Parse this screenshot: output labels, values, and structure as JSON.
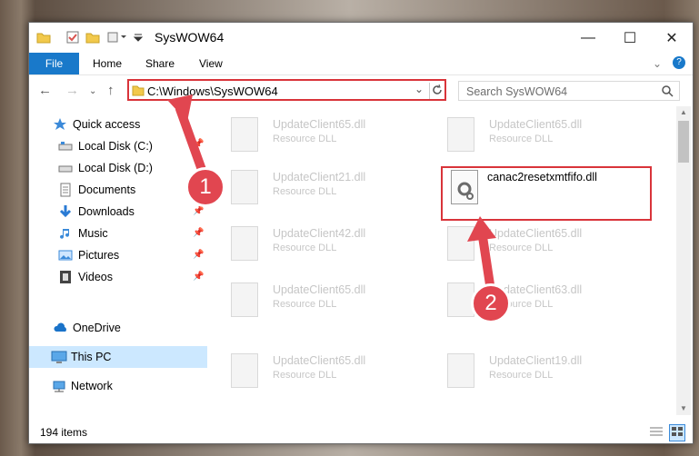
{
  "window": {
    "title": "SysWOW64",
    "controls": {
      "minimize": "—",
      "maximize": "☐",
      "close": "✕"
    }
  },
  "ribbon": {
    "tabs": [
      "File",
      "Home",
      "Share",
      "View"
    ]
  },
  "address": {
    "path": "C:\\Windows\\SysWOW64",
    "search_placeholder": "Search SysWOW64"
  },
  "sidebar": {
    "items": [
      {
        "label": "Quick access",
        "icon": "star-icon"
      },
      {
        "label": "Local Disk (C:)",
        "icon": "drive-icon"
      },
      {
        "label": "Local Disk (D:)",
        "icon": "drive-icon"
      },
      {
        "label": "Documents",
        "icon": "documents-icon"
      },
      {
        "label": "Downloads",
        "icon": "download-icon"
      },
      {
        "label": "Music",
        "icon": "music-icon"
      },
      {
        "label": "Pictures",
        "icon": "pictures-icon"
      },
      {
        "label": "Videos",
        "icon": "videos-icon"
      },
      {
        "label": "OneDrive",
        "icon": "cloud-icon"
      },
      {
        "label": "This PC",
        "icon": "computer-icon"
      },
      {
        "label": "Network",
        "icon": "network-icon"
      }
    ]
  },
  "files": [
    {
      "name": "UpdateClient65.dll",
      "type": "Resource DLL"
    },
    {
      "name": "UpdateClient65.dll",
      "type": "Resource DLL"
    },
    {
      "name": "UpdateClient21.dll",
      "type": "Resource DLL"
    },
    {
      "name": "canac2resetxmtfifo.dll",
      "type": ""
    },
    {
      "name": "UpdateClient42.dll",
      "type": "Resource DLL"
    },
    {
      "name": "UpdateClient65.dll",
      "type": "Resource DLL"
    },
    {
      "name": "UpdateClient65.dll",
      "type": "Resource DLL"
    },
    {
      "name": "UpdateClient63.dll",
      "type": "Resource DLL"
    },
    {
      "name": "UpdateClient65.dll",
      "type": "Resource DLL"
    },
    {
      "name": "UpdateClient19.dll",
      "type": "Resource DLL"
    }
  ],
  "status": {
    "count": "194 items"
  },
  "annotations": {
    "step1": "1",
    "step2": "2",
    "color": "#e14650"
  }
}
